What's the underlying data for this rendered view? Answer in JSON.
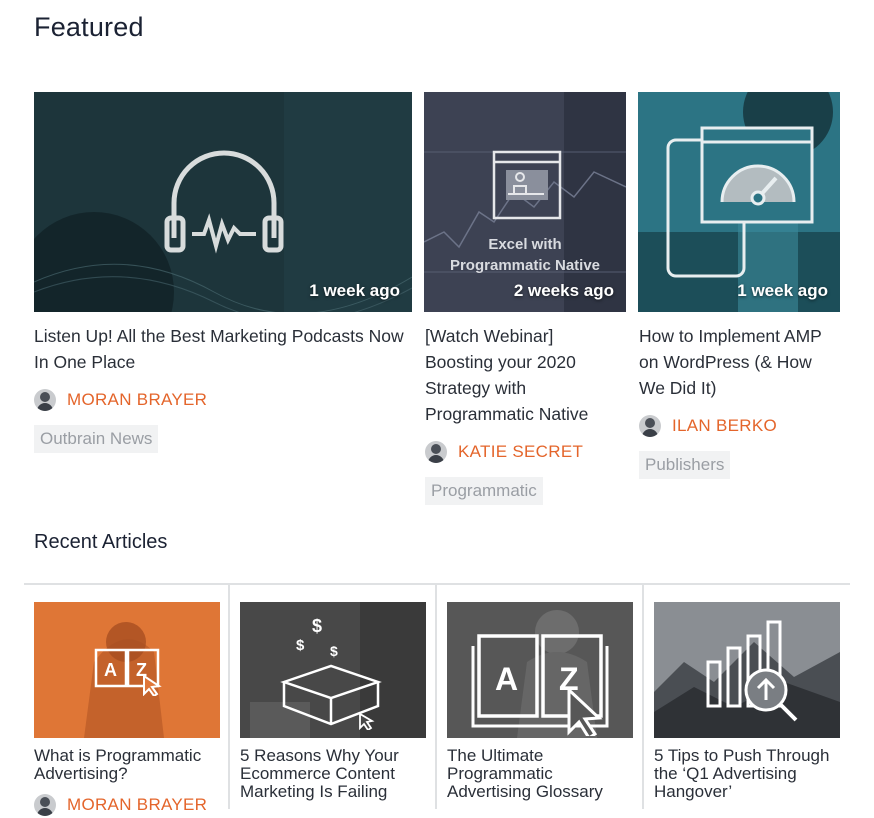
{
  "sections": {
    "featured_title": "Featured",
    "recent_title": "Recent Articles"
  },
  "featured": [
    {
      "time": "1 week ago",
      "title": "Listen Up! All the Best Marketing Podcasts Now In One Place",
      "author": "MORAN BRAYER",
      "tag": "Outbrain News",
      "icon": "headphones-icon"
    },
    {
      "time": "2 weeks ago",
      "image_text_line1": "Excel with",
      "image_text_line2": "Programmatic Native",
      "title": "[Watch Webinar] Boosting your 2020 Strategy with Programmatic Native",
      "author": "KATIE SECRET",
      "tag": "Programmatic",
      "icon": "presentation-icon"
    },
    {
      "time": "1 week ago",
      "title": "How to Implement AMP on WordPress (& How We Did It)",
      "author": "ILAN BERKO",
      "tag": "Publishers",
      "icon": "speed-gauge-icon"
    }
  ],
  "recent": [
    {
      "title": "What is Programmatic Advertising?",
      "author": "MORAN BRAYER",
      "icon": "book-az-icon",
      "accent": "#e0773a"
    },
    {
      "title": "5 Reasons Why Your Ecommerce Content Marketing Is Failing",
      "icon": "open-box-dollar-icon"
    },
    {
      "title": "The Ultimate Programmatic Advertising Glossary",
      "icon": "book-az-icon"
    },
    {
      "title": "5 Tips to Push Through the ‘Q1 Advertising Hangover’",
      "icon": "bar-chart-magnifier-icon"
    }
  ],
  "colors": {
    "accent": "#e4652b",
    "heading": "#1b2233",
    "tag_bg": "#f1f2f3",
    "tag_text": "#9a9ea4"
  }
}
